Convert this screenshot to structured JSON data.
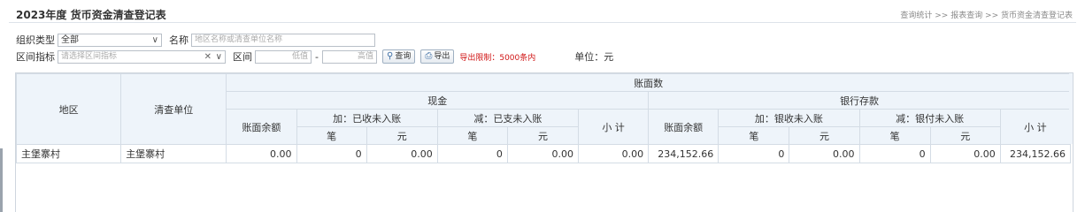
{
  "header": {
    "title": "2023年度 货币资金清查登记表",
    "breadcrumb": "查询统计 >> 报表查询 >> 货币资金清查登记表"
  },
  "filters": {
    "org_type_label": "组织类型",
    "org_type_value": "全部",
    "name_label": "名称",
    "name_placeholder": "地区名称或清查单位名称",
    "range_indicator_label": "区间指标",
    "range_indicator_placeholder": "请选择区间指标",
    "range_label": "区间",
    "low_placeholder": "低值",
    "dash": "-",
    "high_placeholder": "高值",
    "query_button": "查询",
    "export_button": "导出",
    "export_limit": "导出限制：5000条内",
    "unit": "单位：元"
  },
  "table": {
    "headers": {
      "region": "地区",
      "unit_name": "清查单位",
      "book_count": "账面数",
      "cash": "现金",
      "bank": "银行存款",
      "book_balance": "账面余额",
      "add_received": "加：已收未入账",
      "sub_paid": "减：已支未入账",
      "subtotal": "小 计",
      "add_bank_received": "加：银收未入账",
      "sub_bank_paid": "减：银付未入账",
      "count": "笔",
      "yuan": "元"
    },
    "rows": [
      {
        "region": "主堡寨村",
        "unit": "主堡寨村",
        "cash_balance": "0.00",
        "cash_add_count": "0",
        "cash_add_amount": "0.00",
        "cash_sub_count": "0",
        "cash_sub_amount": "0.00",
        "cash_subtotal": "0.00",
        "bank_balance": "234,152.66",
        "bank_add_count": "0",
        "bank_add_amount": "0.00",
        "bank_sub_count": "0",
        "bank_sub_amount": "0.00",
        "bank_subtotal": "234,152.66"
      }
    ]
  },
  "icons": {
    "dropdown": "chevron-down-icon",
    "clear": "close-icon",
    "query": "search-icon",
    "export": "printer-icon"
  }
}
